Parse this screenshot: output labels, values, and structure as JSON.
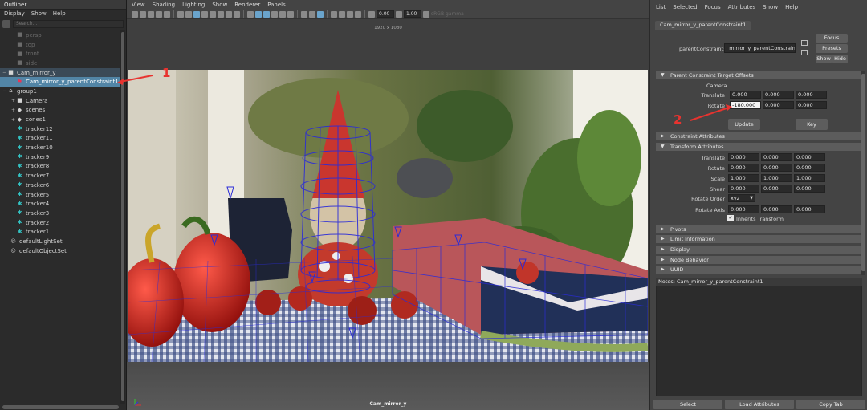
{
  "outliner": {
    "title": "Outliner",
    "menu": [
      "Display",
      "Show",
      "Help"
    ],
    "search_placeholder": "Search...",
    "items": [
      {
        "label": "persp",
        "dim": true
      },
      {
        "label": "top",
        "dim": true
      },
      {
        "label": "front",
        "dim": true
      },
      {
        "label": "side",
        "dim": true
      },
      {
        "label": "Cam_mirror_y"
      },
      {
        "label": "Cam_mirror_y_parentConstraint1",
        "selected": true
      },
      {
        "label": "group1"
      },
      {
        "label": "Camera"
      },
      {
        "label": "scenes"
      },
      {
        "label": "cones1"
      },
      {
        "label": "tracker12"
      },
      {
        "label": "tracker11"
      },
      {
        "label": "tracker10"
      },
      {
        "label": "tracker9"
      },
      {
        "label": "tracker8"
      },
      {
        "label": "tracker7"
      },
      {
        "label": "tracker6"
      },
      {
        "label": "tracker5"
      },
      {
        "label": "tracker4"
      },
      {
        "label": "tracker3"
      },
      {
        "label": "tracker2"
      },
      {
        "label": "tracker1"
      },
      {
        "label": "defaultLightSet"
      },
      {
        "label": "defaultObjectSet"
      }
    ]
  },
  "viewport": {
    "menu": [
      "View",
      "Shading",
      "Lighting",
      "Show",
      "Renderer",
      "Panels"
    ],
    "field_a": "0.00",
    "field_b": "1.00",
    "colorspace": "sRGB gamma",
    "resolution": "1920 x 1080",
    "camera_name": "Cam_mirror_y"
  },
  "attribute_editor": {
    "menu": [
      "List",
      "Selected",
      "Focus",
      "Attributes",
      "Show",
      "Help"
    ],
    "node_tab": "Cam_mirror_y_parentConstraint1",
    "node_label": "parentConstraint:",
    "node_value": "_mirror_y_parentConstraint1",
    "focus": "Focus",
    "presets": "Presets",
    "show": "Show",
    "hide": "Hide",
    "offsets_section": "Parent Constraint Target Offsets",
    "target": "Camera",
    "offset_translate_label": "Translate",
    "offset_translate": [
      "0.000",
      "0.000",
      "0.000"
    ],
    "offset_rotate_label": "Rotate",
    "offset_rotate": [
      "-180.000",
      "0.000",
      "0.000"
    ],
    "update": "Update",
    "key": "Key",
    "constraint_section": "Constraint Attributes",
    "transform_section": "Transform Attributes",
    "translate_label": "Translate",
    "translate": [
      "0.000",
      "0.000",
      "0.000"
    ],
    "rotate_label": "Rotate",
    "rotate": [
      "0.000",
      "0.000",
      "0.000"
    ],
    "scale_label": "Scale",
    "scale": [
      "1.000",
      "1.000",
      "1.000"
    ],
    "shear_label": "Shear",
    "shear": [
      "0.000",
      "0.000",
      "0.000"
    ],
    "rotate_order_label": "Rotate Order",
    "rotate_order": "xyz",
    "rotate_axis_label": "Rotate Axis",
    "rotate_axis": [
      "0.000",
      "0.000",
      "0.000"
    ],
    "inherits_transform": "Inherits Transform",
    "collapsed_sections": [
      "Pivots",
      "Limit Information",
      "Display",
      "Node Behavior",
      "UUID"
    ],
    "notes_label": "Notes:",
    "notes_node": "Cam_mirror_y_parentConstraint1",
    "bottom_buttons": [
      "Select",
      "Load Attributes",
      "Copy Tab"
    ]
  },
  "annotations": {
    "one": "1",
    "two": "2",
    "color": "#e8332f"
  },
  "colors": {
    "selection": "#5285a6",
    "panel": "#444444",
    "outliner_bg": "#2b2b2b"
  }
}
